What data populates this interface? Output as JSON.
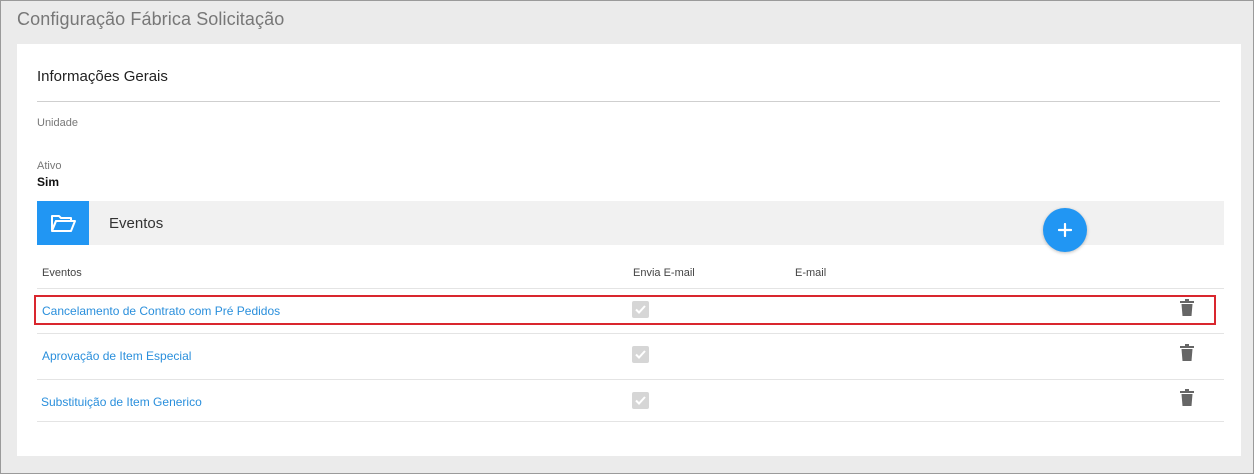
{
  "page": {
    "title": "Configuração Fábrica Solicitação"
  },
  "general": {
    "title": "Informações Gerais",
    "unidade_label": "Unidade",
    "ativo_label": "Ativo",
    "ativo_value": "Sim"
  },
  "events": {
    "title": "Eventos",
    "columns": {
      "eventos": "Eventos",
      "envia_email": "Envia E-mail",
      "email": "E-mail"
    },
    "rows": [
      {
        "name": "Cancelamento de Contrato com Pré Pedidos",
        "envia_email": true,
        "email": ""
      },
      {
        "name": "Aprovação de Item Especial",
        "envia_email": true,
        "email": ""
      },
      {
        "name": "Substituição de Item Generico",
        "envia_email": true,
        "email": ""
      }
    ]
  },
  "icons": {
    "folder": "folder-open-icon",
    "add": "plus-icon",
    "delete": "trash-icon",
    "check": "checkmark-icon"
  },
  "colors": {
    "accent": "#2196f3",
    "link": "#2a8fdc",
    "highlight": "#d9262e"
  }
}
